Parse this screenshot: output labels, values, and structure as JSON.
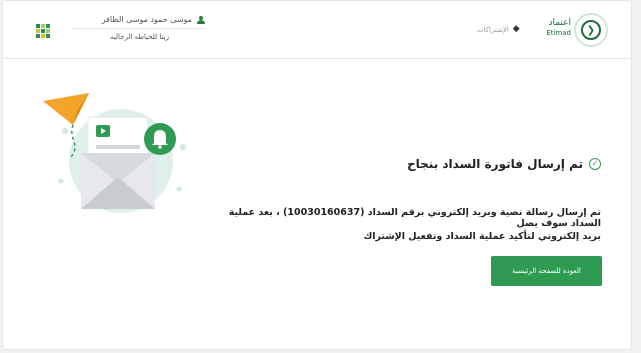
{
  "header": {
    "user_name": "موسى حمود موسى الظافر",
    "company": "زينا للخياطه الرجاليه",
    "subscriptions_label": "الإشتراكات",
    "logo_ar": "اعتماد",
    "logo_en": "Etimad",
    "grid_colors": [
      "#2e8b57",
      "#9ccc65",
      "#2e8b57",
      "#c0ca33",
      "#2e8b57",
      "#9ccc65",
      "#2e8b57",
      "#c0ca33",
      "#2e8b57"
    ]
  },
  "main": {
    "title": "تم إرسال فاتورة السداد بنجاح",
    "message_line1": "تم إرسال رسالة نصية وبريد إلكتروني برقم السداد (10030160637) ، بعد عملية السداد سوف يصل",
    "message_line2": "بريد إلكتروني لتأكيد عملية السداد وتفعيل الإشتراك",
    "home_button": "العودة للصفحة الرئيسية"
  },
  "colors": {
    "brand_green": "#2f9a52",
    "dark_green": "#1e6f39"
  },
  "icons": [
    "grid-icon",
    "user-icon",
    "layers-icon",
    "etimad-logo",
    "check-circle-icon",
    "email-illustration"
  ]
}
